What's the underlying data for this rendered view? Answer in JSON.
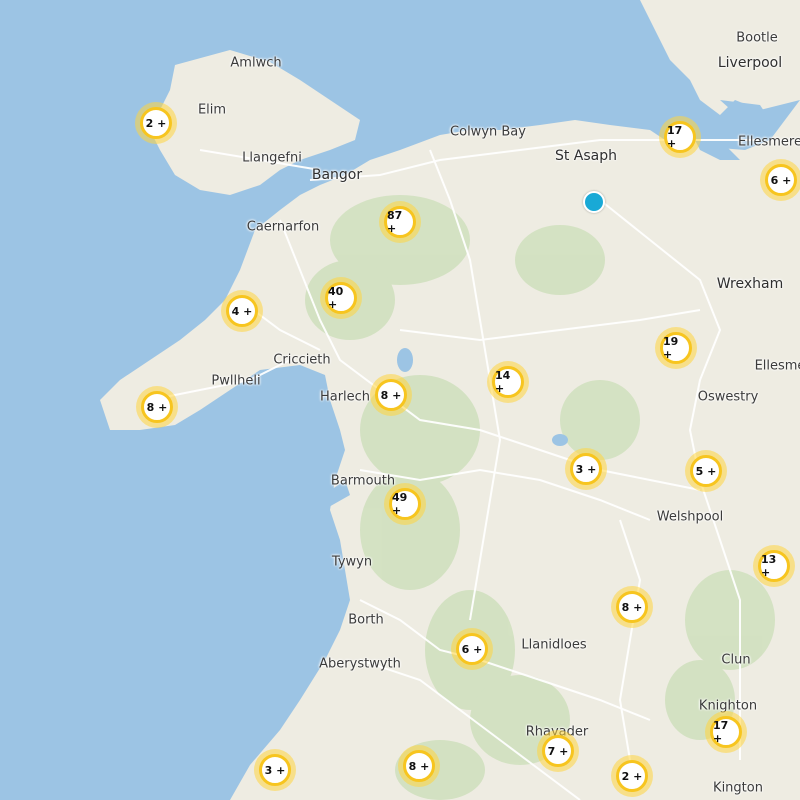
{
  "map": {
    "colors": {
      "sea": "#9cc4e4",
      "land": "#eeece2",
      "forest": "#cfe0bd",
      "road": "#ffffff",
      "cluster_fill": "#ffffff",
      "cluster_ring": "#f7c51f",
      "cluster_halo": "#ffd640",
      "pin": "#19a9d6"
    },
    "places": [
      {
        "name": "Bootle",
        "kind": "town"
      },
      {
        "name": "Liverpool",
        "kind": "city"
      },
      {
        "name": "Amlwch",
        "kind": "town"
      },
      {
        "name": "Elim",
        "kind": "town"
      },
      {
        "name": "Colwyn Bay",
        "kind": "town"
      },
      {
        "name": "Ellesmere",
        "kind": "town"
      },
      {
        "name": "St Asaph",
        "kind": "city"
      },
      {
        "name": "Llangefni",
        "kind": "town"
      },
      {
        "name": "Bangor",
        "kind": "city"
      },
      {
        "name": "Caernarfon",
        "kind": "town"
      },
      {
        "name": "Wrexham",
        "kind": "city"
      },
      {
        "name": "Criccieth",
        "kind": "town"
      },
      {
        "name": "Pwllheli",
        "kind": "town"
      },
      {
        "name": "Ellesme",
        "kind": "town"
      },
      {
        "name": "Harlech",
        "kind": "town"
      },
      {
        "name": "Oswestry",
        "kind": "town"
      },
      {
        "name": "Barmouth",
        "kind": "town"
      },
      {
        "name": "Welshpool",
        "kind": "town"
      },
      {
        "name": "Tywyn",
        "kind": "town"
      },
      {
        "name": "Borth",
        "kind": "town"
      },
      {
        "name": "Llanidloes",
        "kind": "town"
      },
      {
        "name": "Aberystwyth",
        "kind": "town"
      },
      {
        "name": "Clun",
        "kind": "town"
      },
      {
        "name": "Knighton",
        "kind": "town"
      },
      {
        "name": "Rhayader",
        "kind": "town"
      },
      {
        "name": "Kington",
        "kind": "town"
      }
    ],
    "clusters": [
      {
        "label": "2 +"
      },
      {
        "label": "17 +"
      },
      {
        "label": "6 +"
      },
      {
        "label": "87 +"
      },
      {
        "label": "40 +"
      },
      {
        "label": "4 +"
      },
      {
        "label": "19 +"
      },
      {
        "label": "14 +"
      },
      {
        "label": "8 +"
      },
      {
        "label": "8 +"
      },
      {
        "label": "3 +"
      },
      {
        "label": "5 +"
      },
      {
        "label": "49 +"
      },
      {
        "label": "13 +"
      },
      {
        "label": "8 +"
      },
      {
        "label": "6 +"
      },
      {
        "label": "17 +"
      },
      {
        "label": "7 +"
      },
      {
        "label": "3 +"
      },
      {
        "label": "8 +"
      },
      {
        "label": "2 +"
      }
    ],
    "marker": {
      "icon": "location-pin-icon"
    }
  }
}
